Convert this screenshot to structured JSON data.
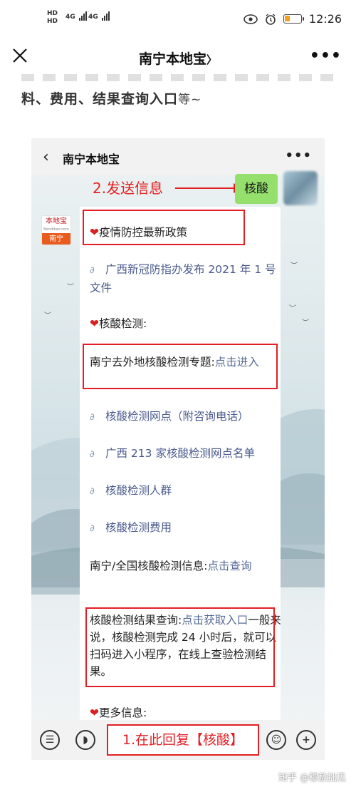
{
  "status_bar": {
    "left_indicators": [
      "HD",
      "HD",
      "4G",
      "4G"
    ],
    "time": "12:26",
    "battery_level": 0.3,
    "icons": [
      "eye-icon",
      "alarm-icon",
      "battery-icon"
    ]
  },
  "nav": {
    "title": "南宁本地宝",
    "chevron": "〉",
    "more": "•••"
  },
  "article": {
    "text_bold": "料、费用、结果查询入口",
    "text_tail": "等~"
  },
  "embedded": {
    "header_title": "南宁本地宝",
    "annotation_send": "2.发送信息",
    "user_message": "核酸",
    "bot_avatar": {
      "top": "本地宝",
      "top_sub": "Bendibao.com",
      "bottom": "南宁"
    },
    "rows": {
      "policy": "疫情防控最新政策",
      "link1": "广西新冠防指办发布 2021 年 1 号文件",
      "test_header": "核酸检测:",
      "topic_prefix": "南宁去外地核酸检测专题:",
      "topic_link": "点击进入",
      "link2": "核酸检测网点（附咨询电话）",
      "link3": "广西 213 家核酸检测网点名单",
      "link4": "核酸检测人群",
      "link5": "核酸检测费用",
      "info_prefix": "南宁/全国核酸检测信息:",
      "info_link": "点击查询",
      "result_prefix": "核酸检测结果查询:",
      "result_link": "点击获取入口",
      "result_body": "一般来说，核酸检测完成 24 小时后，就可以扫码进入小程序，在线上查验检测结果。",
      "more": "更多信息:"
    },
    "footer": {
      "annotation_reply": "1.在此回复【核酸】"
    }
  },
  "watermark": "知乎 @穆敖拙见",
  "colors": {
    "annotation": "#e31e24",
    "link": "#576b95",
    "bubble": "#95e06c",
    "badge": "#e95c1f"
  }
}
